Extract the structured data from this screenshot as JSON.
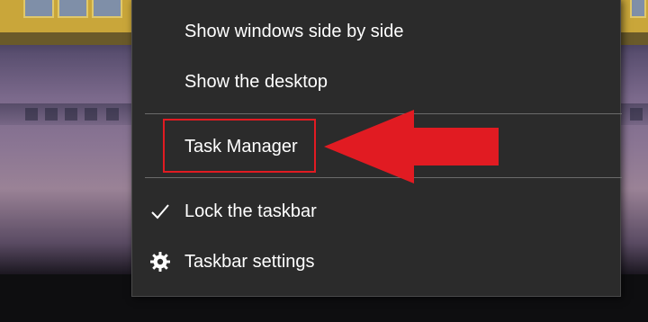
{
  "context_menu": {
    "items": [
      {
        "label": "Show windows side by side",
        "icon": null
      },
      {
        "label": "Show the desktop",
        "icon": null
      },
      {
        "label": "Task Manager",
        "icon": null
      },
      {
        "label": "Lock the taskbar",
        "icon": "checkmark-icon"
      },
      {
        "label": "Taskbar settings",
        "icon": "gear-icon"
      }
    ]
  },
  "annotation": {
    "highlight_color": "#e11b22",
    "arrow_color": "#e11b22",
    "target": "Task Manager"
  },
  "colors": {
    "menu_background": "#2b2b2b",
    "menu_text": "#ffffff",
    "separator": "#6b6b6b"
  }
}
